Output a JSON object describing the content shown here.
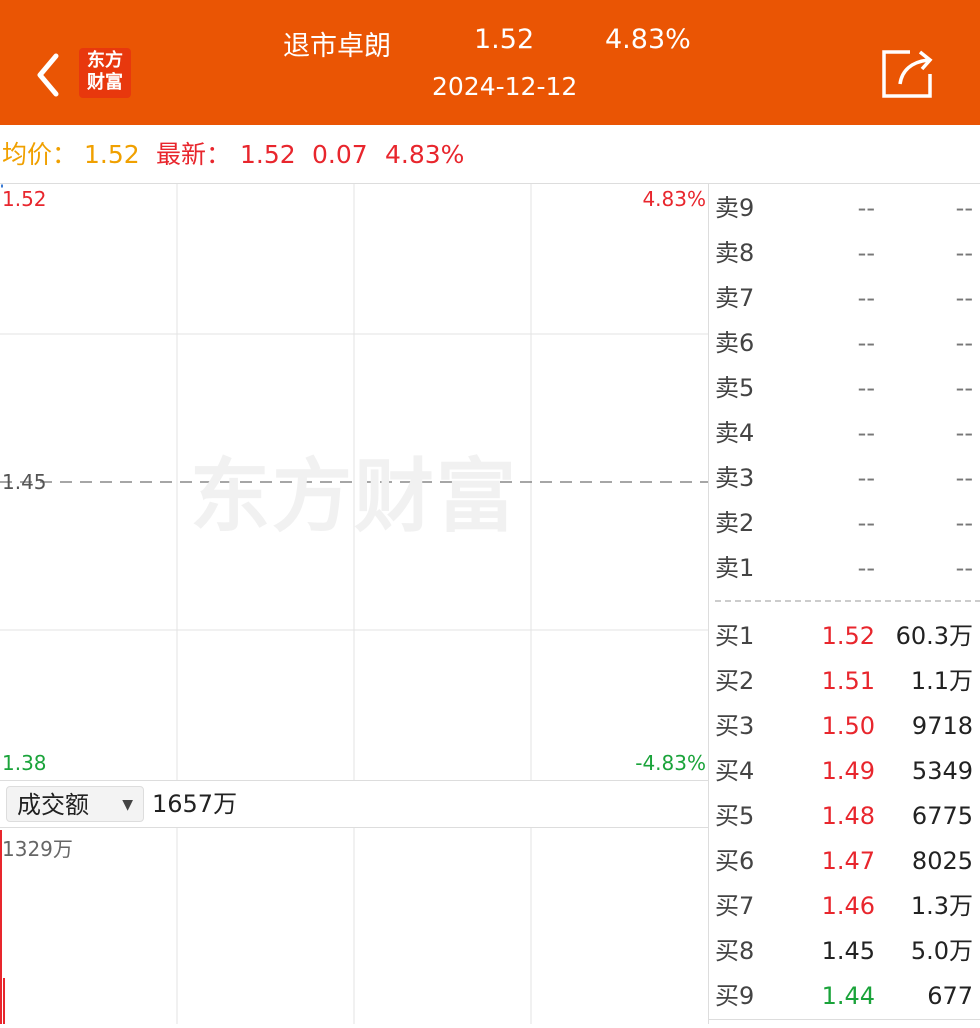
{
  "header": {
    "logo_text": "东方\n财富",
    "stock_name": "退市卓朗",
    "price": "1.52",
    "change_pct": "4.83%",
    "date": "2024-12-12",
    "accent_color": "#ea5504"
  },
  "info": {
    "avg_label": "均价：",
    "avg_value": "1.52",
    "latest_label": "最新：",
    "latest_value": "1.52",
    "change": "0.07",
    "change_pct": "4.83%"
  },
  "chart": {
    "top_price": "1.52",
    "top_pct": "4.83%",
    "mid_price": "1.45",
    "bottom_price": "1.38",
    "bottom_pct": "-4.83%",
    "watermark": "东方财富"
  },
  "volume": {
    "selector_label": "成交额",
    "total": "1657万",
    "max_label": "1329万"
  },
  "order_book": {
    "sell": [
      {
        "label": "卖9",
        "price": "--",
        "volume": "--"
      },
      {
        "label": "卖8",
        "price": "--",
        "volume": "--"
      },
      {
        "label": "卖7",
        "price": "--",
        "volume": "--"
      },
      {
        "label": "卖6",
        "price": "--",
        "volume": "--"
      },
      {
        "label": "卖5",
        "price": "--",
        "volume": "--"
      },
      {
        "label": "卖4",
        "price": "--",
        "volume": "--"
      },
      {
        "label": "卖3",
        "price": "--",
        "volume": "--"
      },
      {
        "label": "卖2",
        "price": "--",
        "volume": "--"
      },
      {
        "label": "卖1",
        "price": "--",
        "volume": "--"
      }
    ],
    "buy": [
      {
        "label": "买1",
        "price": "1.52",
        "volume": "60.3万",
        "color": "red"
      },
      {
        "label": "买2",
        "price": "1.51",
        "volume": "1.1万",
        "color": "red"
      },
      {
        "label": "买3",
        "price": "1.50",
        "volume": "9718",
        "color": "red"
      },
      {
        "label": "买4",
        "price": "1.49",
        "volume": "5349",
        "color": "red"
      },
      {
        "label": "买5",
        "price": "1.48",
        "volume": "6775",
        "color": "red"
      },
      {
        "label": "买6",
        "price": "1.47",
        "volume": "8025",
        "color": "red"
      },
      {
        "label": "买7",
        "price": "1.46",
        "volume": "1.3万",
        "color": "red"
      },
      {
        "label": "买8",
        "price": "1.45",
        "volume": "5.0万",
        "color": "black"
      },
      {
        "label": "买9",
        "price": "1.44",
        "volume": "677",
        "color": "green"
      }
    ]
  }
}
